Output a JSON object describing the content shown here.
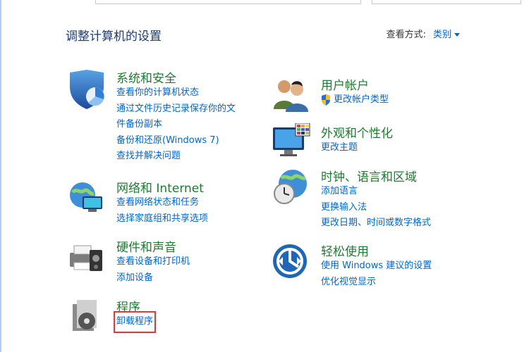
{
  "page": {
    "title": "调整计算机的设置",
    "view_by_label": "查看方式:",
    "view_by_value": "类别"
  },
  "categories": {
    "system": {
      "title": "系统和安全",
      "links": [
        "查看你的计算机状态",
        "通过文件历史记录保存你的文",
        "件备份副本",
        "备份和还原(Windows 7)",
        "查找并解决问题"
      ]
    },
    "network": {
      "title": "网络和 Internet",
      "links": [
        "查看网络状态和任务",
        "选择家庭组和共享选项"
      ]
    },
    "hardware": {
      "title": "硬件和声音",
      "links": [
        "查看设备和打印机",
        "添加设备"
      ]
    },
    "programs": {
      "title": "程序",
      "links": [
        "卸载程序"
      ]
    },
    "user": {
      "title": "用户帐户",
      "links": [
        "更改帐户类型"
      ]
    },
    "appearance": {
      "title": "外观和个性化",
      "links": [
        "更改主题"
      ]
    },
    "clock": {
      "title": "时钟、语言和区域",
      "links": [
        "添加语言",
        "更换输入法",
        "更改日期、时间或数字格式"
      ]
    },
    "ease": {
      "title": "轻松使用",
      "links": [
        "使用 Windows 建议的设置",
        "优化视觉显示"
      ]
    }
  },
  "colors": {
    "category_title": "#1e7b2f",
    "link": "#0066cc",
    "highlight": "#d93a3a"
  }
}
